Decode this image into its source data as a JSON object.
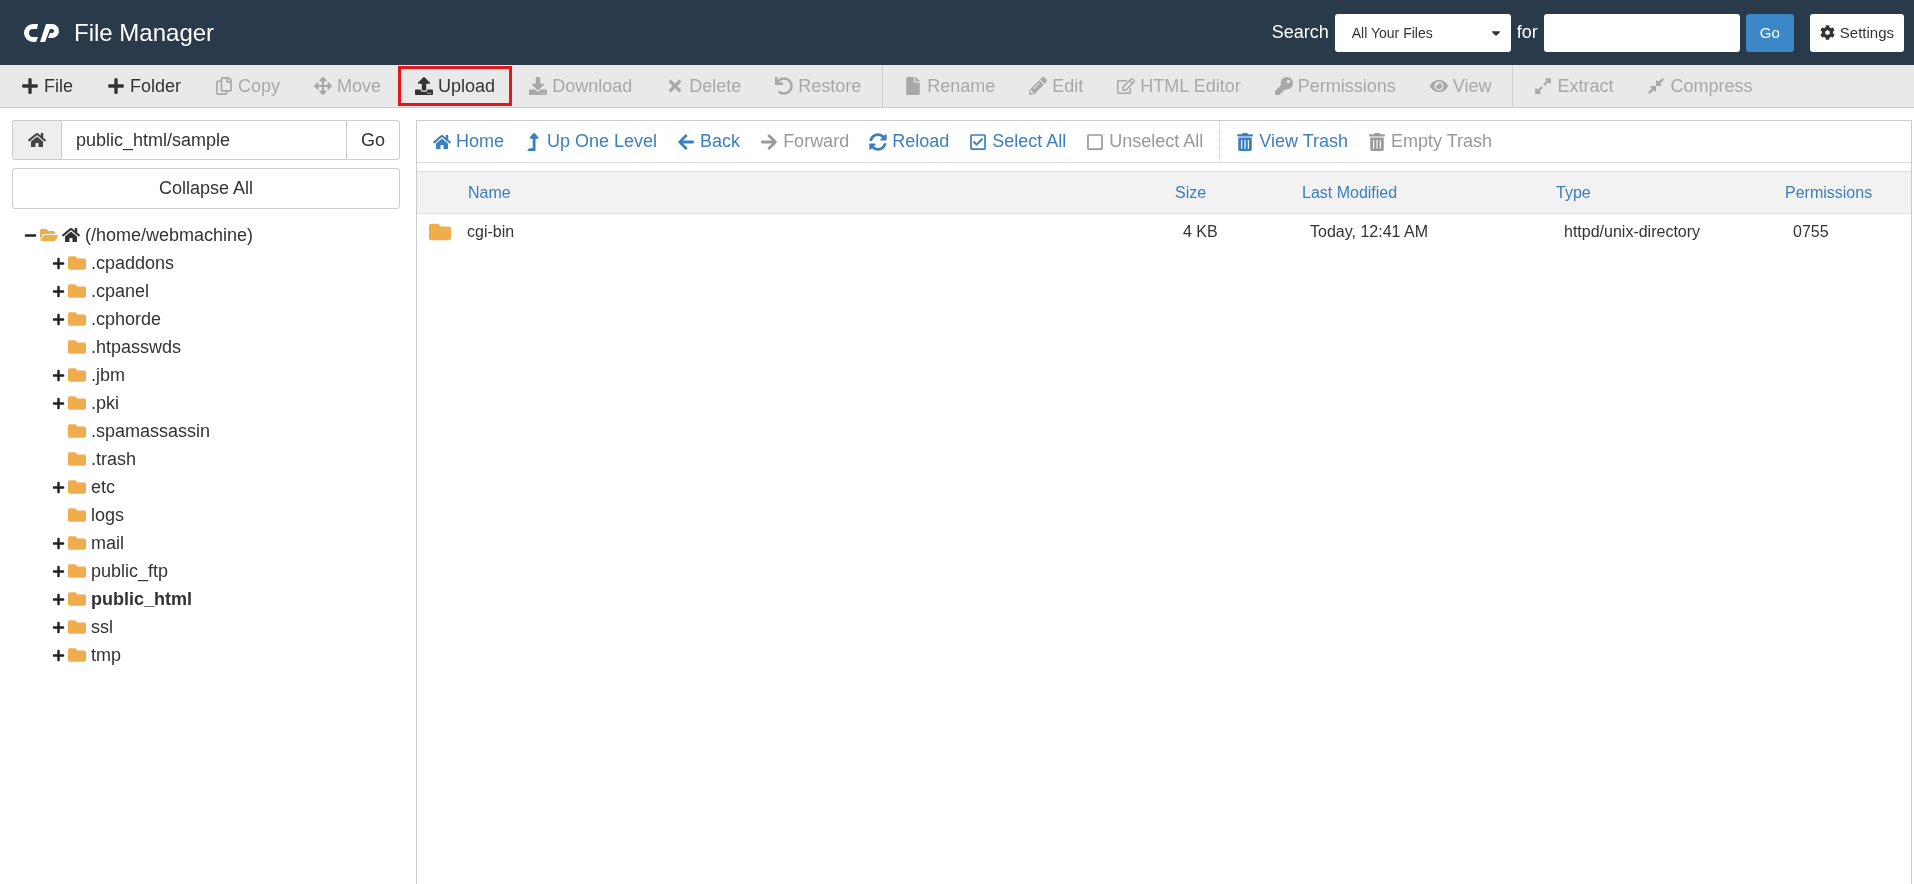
{
  "header": {
    "title": "File Manager",
    "search_label": "Search",
    "scope": "All Your Files",
    "for_label": "for",
    "go": "Go",
    "settings": "Settings"
  },
  "toolbar": {
    "groups": [
      [
        {
          "label": "File",
          "disabled": false,
          "highlighted": false
        },
        {
          "label": "Folder",
          "disabled": false,
          "highlighted": false
        },
        {
          "label": "Copy",
          "disabled": true,
          "highlighted": false
        },
        {
          "label": "Move",
          "disabled": true,
          "highlighted": false
        },
        {
          "label": "Upload",
          "disabled": false,
          "highlighted": true
        },
        {
          "label": "Download",
          "disabled": true,
          "highlighted": false
        },
        {
          "label": "Delete",
          "disabled": true,
          "highlighted": false
        },
        {
          "label": "Restore",
          "disabled": true,
          "highlighted": false
        }
      ],
      [
        {
          "label": "Rename",
          "disabled": true,
          "highlighted": false
        },
        {
          "label": "Edit",
          "disabled": true,
          "highlighted": false
        },
        {
          "label": "HTML Editor",
          "disabled": true,
          "highlighted": false
        },
        {
          "label": "Permissions",
          "disabled": true,
          "highlighted": false
        },
        {
          "label": "View",
          "disabled": true,
          "highlighted": false
        }
      ],
      [
        {
          "label": "Extract",
          "disabled": true,
          "highlighted": false
        },
        {
          "label": "Compress",
          "disabled": true,
          "highlighted": false
        }
      ]
    ]
  },
  "path_bar": {
    "value": "public_html/sample",
    "go": "Go"
  },
  "collapse_all": "Collapse All",
  "tree": [
    {
      "name": "(/home/webmachine)",
      "expandable": true,
      "expanded": true,
      "selected": false,
      "children": [
        {
          "name": ".cpaddons",
          "expandable": true,
          "expanded": false,
          "selected": false
        },
        {
          "name": ".cpanel",
          "expandable": true,
          "expanded": false,
          "selected": false
        },
        {
          "name": ".cphorde",
          "expandable": true,
          "expanded": false,
          "selected": false
        },
        {
          "name": ".htpasswds",
          "expandable": false,
          "expanded": false,
          "selected": false
        },
        {
          "name": ".jbm",
          "expandable": true,
          "expanded": false,
          "selected": false
        },
        {
          "name": ".pki",
          "expandable": true,
          "expanded": false,
          "selected": false
        },
        {
          "name": ".spamassassin",
          "expandable": false,
          "expanded": false,
          "selected": false
        },
        {
          "name": ".trash",
          "expandable": false,
          "expanded": false,
          "selected": false
        },
        {
          "name": "etc",
          "expandable": true,
          "expanded": false,
          "selected": false
        },
        {
          "name": "logs",
          "expandable": false,
          "expanded": false,
          "selected": false
        },
        {
          "name": "mail",
          "expandable": true,
          "expanded": false,
          "selected": false
        },
        {
          "name": "public_ftp",
          "expandable": true,
          "expanded": false,
          "selected": false
        },
        {
          "name": "public_html",
          "expandable": true,
          "expanded": false,
          "selected": true
        },
        {
          "name": "ssl",
          "expandable": true,
          "expanded": false,
          "selected": false
        },
        {
          "name": "tmp",
          "expandable": true,
          "expanded": false,
          "selected": false
        }
      ]
    }
  ],
  "nav": {
    "groups": [
      [
        {
          "label": "Home",
          "disabled": false
        },
        {
          "label": "Up One Level",
          "disabled": false
        },
        {
          "label": "Back",
          "disabled": false
        },
        {
          "label": "Forward",
          "disabled": true
        },
        {
          "label": "Reload",
          "disabled": false
        },
        {
          "label": "Select All",
          "disabled": false
        },
        {
          "label": "Unselect All",
          "disabled": true
        }
      ],
      [
        {
          "label": "View Trash",
          "disabled": false
        },
        {
          "label": "Empty Trash",
          "disabled": true
        }
      ]
    ]
  },
  "table": {
    "columns": [
      "Name",
      "Size",
      "Last Modified",
      "Type",
      "Permissions"
    ],
    "rows": [
      {
        "name": "cgi-bin",
        "size": "4 KB",
        "modified": "Today, 12:41 AM",
        "type": "httpd/unix-directory",
        "permissions": "0755",
        "selected": false
      }
    ]
  }
}
